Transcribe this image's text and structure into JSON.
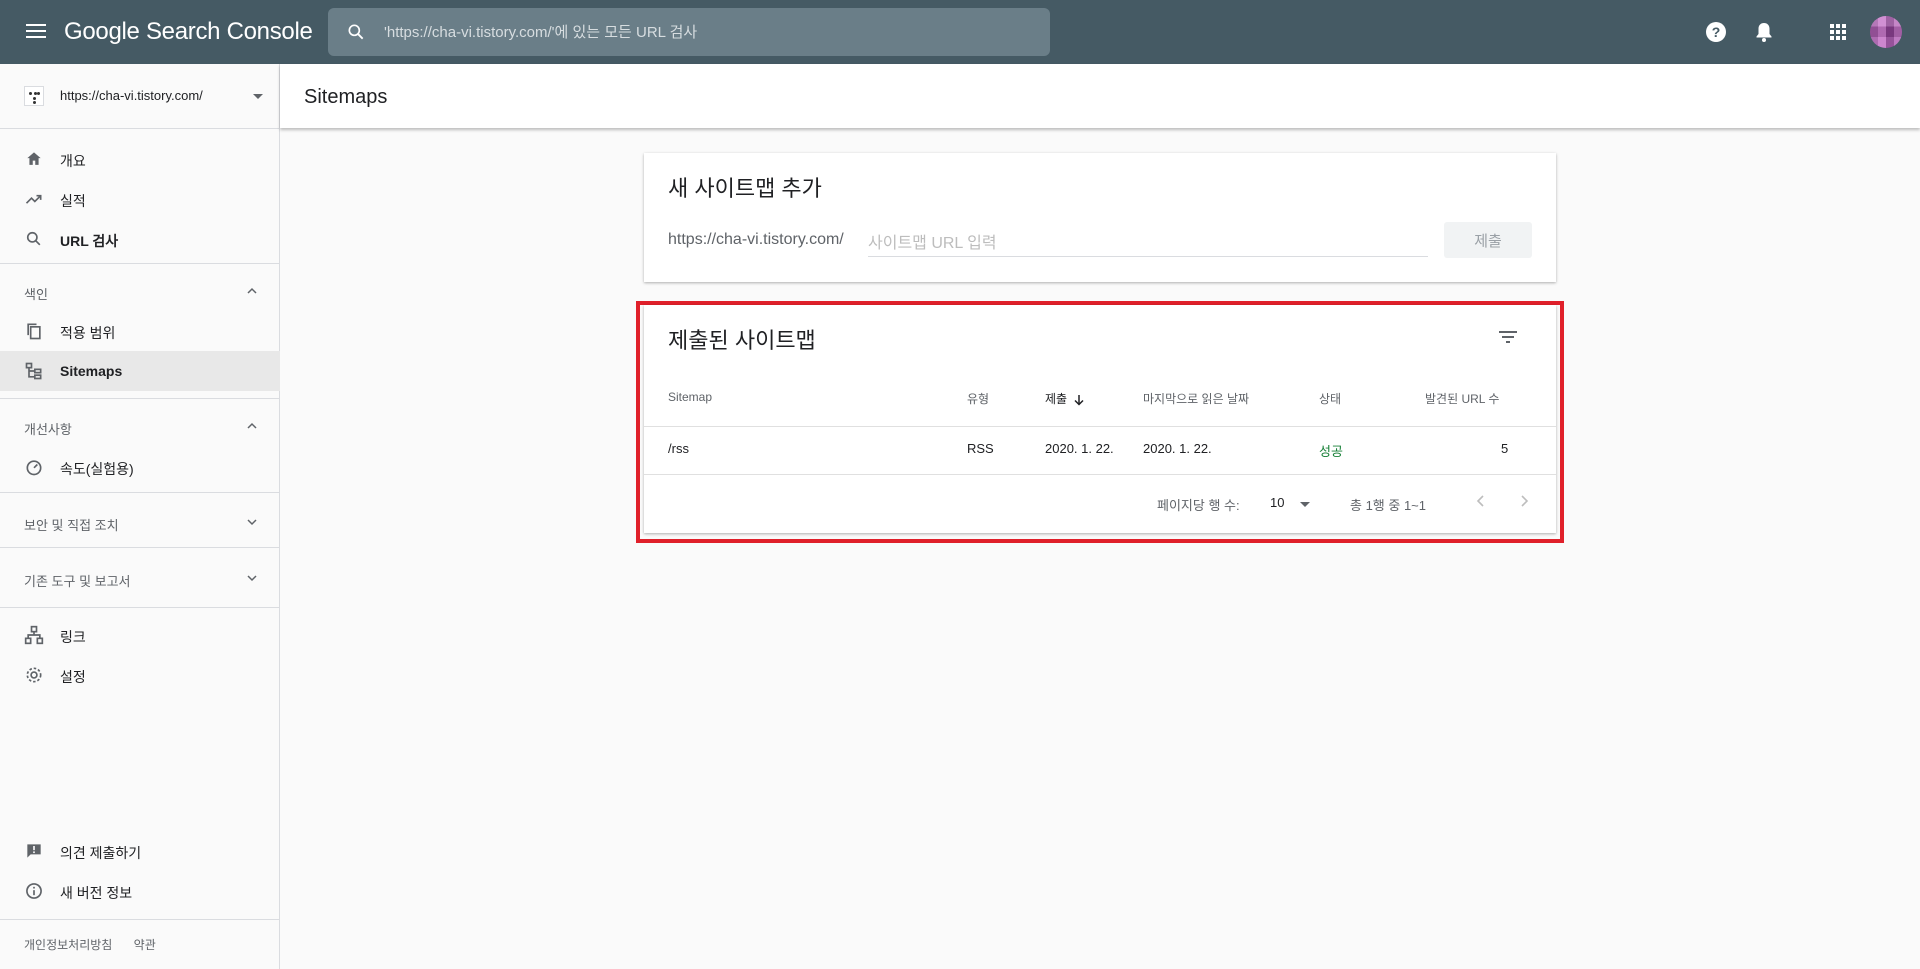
{
  "app": {
    "brand": "Google Search Console",
    "search_placeholder": "'https://cha-vi.tistory.com/'에 있는 모든 URL 검사"
  },
  "sidebar": {
    "property_url": "https://cha-vi.tistory.com/",
    "items_top": [
      {
        "label": "개요",
        "icon": "home-icon"
      },
      {
        "label": "실적",
        "icon": "trending-up-icon"
      },
      {
        "label": "URL 검사",
        "icon": "search-icon"
      }
    ],
    "section_index": {
      "label": "색인",
      "items": [
        {
          "label": "적용 범위",
          "icon": "coverage-icon"
        },
        {
          "label": "Sitemaps",
          "icon": "sitemap-icon"
        }
      ]
    },
    "section_enhancements": {
      "label": "개선사항",
      "items": [
        {
          "label": "속도(실험용)",
          "icon": "speed-icon"
        }
      ]
    },
    "section_security": {
      "label": "보안 및 직접 조치"
    },
    "section_legacy": {
      "label": "기존 도구 및 보고서"
    },
    "items_bottom": [
      {
        "label": "링크",
        "icon": "links-icon"
      },
      {
        "label": "설정",
        "icon": "settings-icon"
      }
    ],
    "items_footer": [
      {
        "label": "의견 제출하기",
        "icon": "feedback-icon"
      },
      {
        "label": "새 버전 정보",
        "icon": "info-icon"
      }
    ],
    "footer_links": [
      "개인정보처리방침",
      "약관"
    ]
  },
  "main": {
    "page_title": "Sitemaps",
    "add_card": {
      "title": "새 사이트맵 추가",
      "prefix": "https://cha-vi.tistory.com/",
      "input_placeholder": "사이트맵 URL 입력",
      "submit_label": "제출"
    },
    "submitted_card": {
      "title": "제출된 사이트맵",
      "columns": [
        "Sitemap",
        "유형",
        "제출",
        "마지막으로 읽은 날짜",
        "상태",
        "발견된 URL 수"
      ],
      "rows": [
        {
          "sitemap": "/rss",
          "type": "RSS",
          "submitted": "2020. 1. 22.",
          "last_read": "2020. 1. 22.",
          "status": "성공",
          "urls": "5"
        }
      ],
      "rows_per_page_label": "페이지당 행 수:",
      "rows_per_page_value": "10",
      "range_label": "총 1행 중 1~1"
    }
  },
  "colors": {
    "topbar": "#455a64",
    "highlight_border": "#e0202a",
    "status_success": "#188038"
  }
}
